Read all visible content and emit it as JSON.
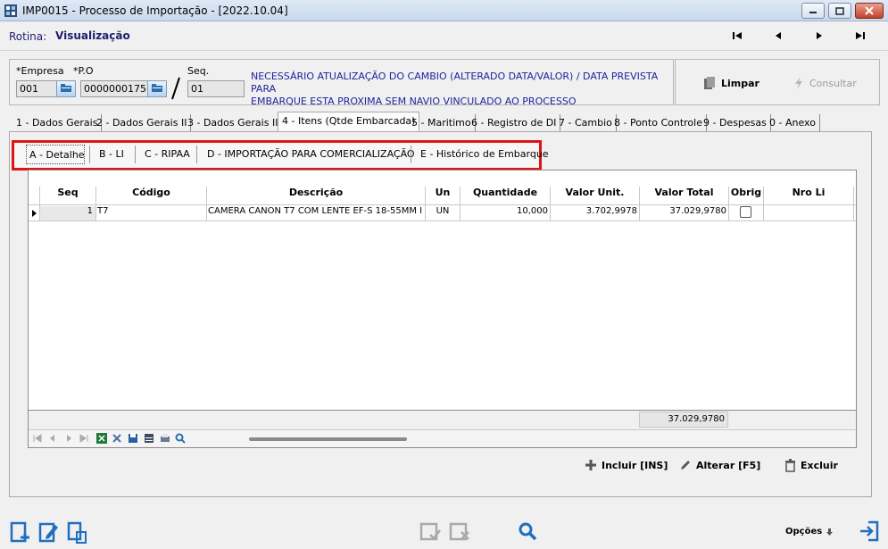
{
  "window": {
    "title": "IMP0015 - Processo de Importação - [2022.10.04]"
  },
  "rotina": {
    "label": "Rotina:",
    "value": "Visualização"
  },
  "header": {
    "empresa_label": "*Empresa",
    "empresa_value": "001",
    "po_label": "*P.O",
    "po_value": "0000000175",
    "seq_label": "Seq.",
    "seq_value": "01",
    "message_line1": "NECESSÁRIO ATUALIZAÇÃO DO CAMBIO (ALTERADO DATA/VALOR) / DATA PREVISTA PARA",
    "message_line2": "EMBARQUE ESTA PROXIMA SEM NAVIO VINCULADO AO PROCESSO"
  },
  "buttons": {
    "limpar": "Limpar",
    "consultar": "Consultar"
  },
  "tabs": [
    "1 - Dados Gerais",
    "2 - Dados Gerais II",
    "3 - Dados Gerais III",
    "4 - Itens (Qtde Embarcada)",
    "5 - Maritimo",
    "6 - Registro de DI",
    "7 - Cambio",
    "8 - Ponto Controle",
    "9 - Despesas",
    "0 - Anexo"
  ],
  "subtabs": [
    "A - Detalhe",
    "B - LI",
    "C - RIPAA",
    "D - IMPORTAÇÃO PARA COMERCIALIZAÇÃO",
    "E - Histórico de Embarque"
  ],
  "grid": {
    "columns": [
      "Seq",
      "Código",
      "Descrição",
      "Un",
      "Quantidade",
      "Valor Unit.",
      "Valor Total",
      "Obrig",
      "Nro Li"
    ],
    "rows": [
      {
        "seq": "1",
        "codigo": "T7",
        "descricao": "CAMERA CANON T7 COM LENTE EF-S 18-55MM I",
        "un": "UN",
        "quantidade": "10,000",
        "valor_unit": "3.702,9978",
        "valor_total": "37.029,9780",
        "obrig": false,
        "nro_li": ""
      }
    ],
    "total": "37.029,9780"
  },
  "actions": {
    "incluir": "Incluir [INS]",
    "alterar": "Alterar [F5]",
    "excluir": "Excluir"
  },
  "footer": {
    "opcoes": "Opções"
  }
}
